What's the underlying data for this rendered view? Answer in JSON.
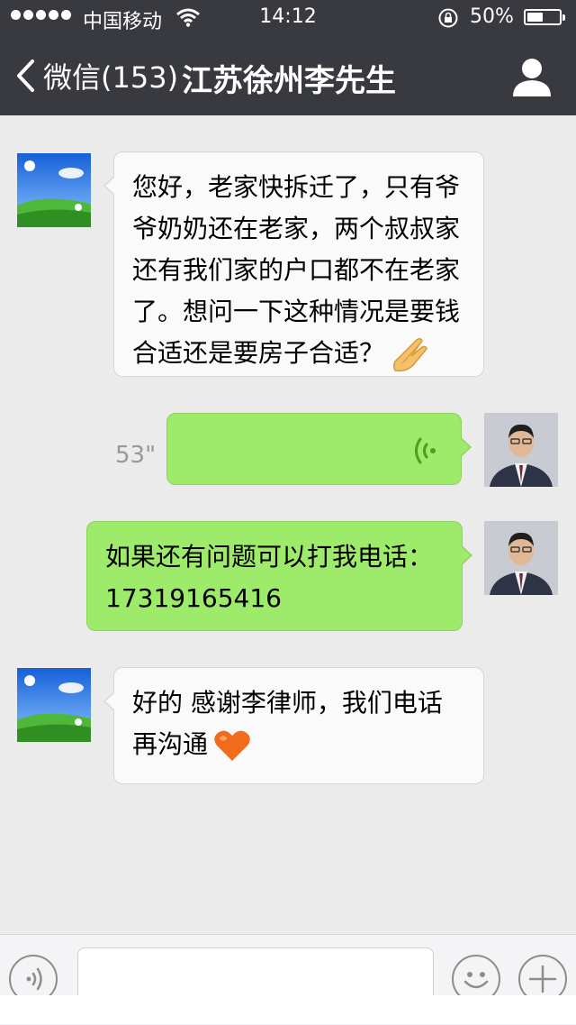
{
  "status_bar": {
    "carrier": "中国移动",
    "time": "14:12",
    "battery_pct": "50%",
    "battery_level": 0.5
  },
  "nav": {
    "back_label": "微信(153)",
    "title": "江苏徐州李先生"
  },
  "messages": [
    {
      "side": "incoming",
      "text": "您好，老家快拆迁了，只有爷\n爷奶奶还在老家，两个叔叔家\n还有我们家的户口都不在老家\n了。想问一下这种情况是要钱\n合适还是要房子合适？",
      "emoji": "folded-hands-emoji"
    },
    {
      "side": "outgoing",
      "type": "voice",
      "duration": "53\""
    },
    {
      "side": "outgoing",
      "text": "如果还有问题可以打我电话：\n17319165416"
    },
    {
      "side": "incoming",
      "text": "好的 感谢李律师，我们电话\n再沟通",
      "emoji": "orange-heart-emoji"
    }
  ],
  "colors": {
    "header_bg": "#393a3f",
    "chat_bg": "#ebebeb",
    "outgoing_bubble": "#9eea6a",
    "incoming_bubble": "#fafafa"
  }
}
